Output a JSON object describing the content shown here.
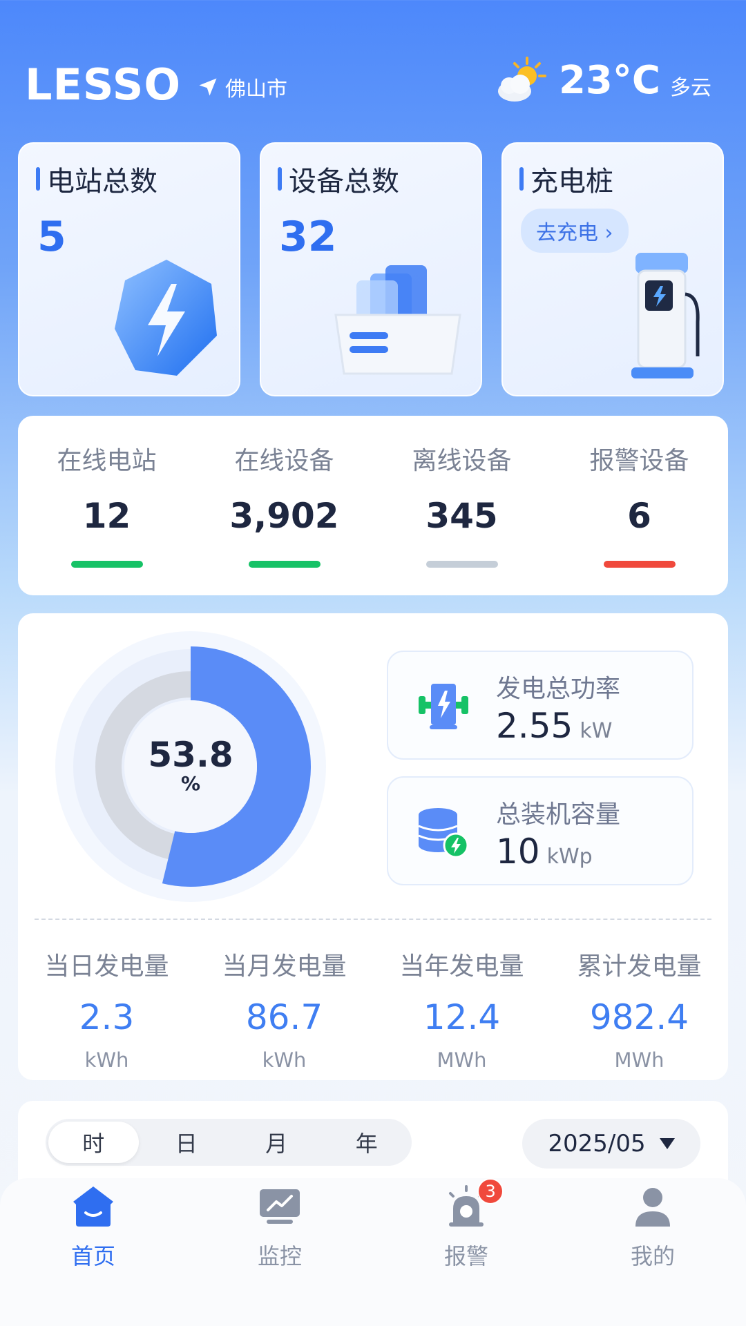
{
  "header": {
    "logo": "LESSO",
    "location": "佛山市",
    "temperature": "23°C",
    "weather": "多云"
  },
  "top_cards": [
    {
      "title": "电站总数",
      "value": "5"
    },
    {
      "title": "设备总数",
      "value": "32"
    },
    {
      "title": "充电桩",
      "action": "去充电"
    }
  ],
  "stats": [
    {
      "label": "在线电站",
      "value": "12",
      "bar_color": "#16c266"
    },
    {
      "label": "在线设备",
      "value": "3,902",
      "bar_color": "#16c266"
    },
    {
      "label": "离线设备",
      "value": "345",
      "bar_color": "#c5ced8"
    },
    {
      "label": "报警设备",
      "value": "6",
      "bar_color": "#f0493c"
    }
  ],
  "power": {
    "percent_value": "53.8",
    "percent_unit": "%",
    "percent_fraction": 0.538,
    "metrics": [
      {
        "label": "发电总功率",
        "value": "2.55",
        "unit": "kW"
      },
      {
        "label": "总装机容量",
        "value": "10",
        "unit": "kWp"
      }
    ],
    "generation": [
      {
        "label": "当日发电量",
        "value": "2.3",
        "unit": "kWh"
      },
      {
        "label": "当月发电量",
        "value": "86.7",
        "unit": "kWh"
      },
      {
        "label": "当年发电量",
        "value": "12.4",
        "unit": "MWh"
      },
      {
        "label": "累计发电量",
        "value": "982.4",
        "unit": "MWh"
      }
    ]
  },
  "period": {
    "tabs": [
      "时",
      "日",
      "月",
      "年"
    ],
    "selected": "时",
    "date": "2025/05"
  },
  "tabbar": [
    {
      "label": "首页",
      "icon": "home-icon",
      "active": true
    },
    {
      "label": "监控",
      "icon": "monitor-icon",
      "active": false
    },
    {
      "label": "报警",
      "icon": "alarm-icon",
      "active": false,
      "badge": "3"
    },
    {
      "label": "我的",
      "icon": "user-icon",
      "active": false
    }
  ],
  "colors": {
    "accent": "#2f6ef0",
    "online": "#16c266",
    "offline": "#c5ced8",
    "alarm": "#f0493c"
  }
}
